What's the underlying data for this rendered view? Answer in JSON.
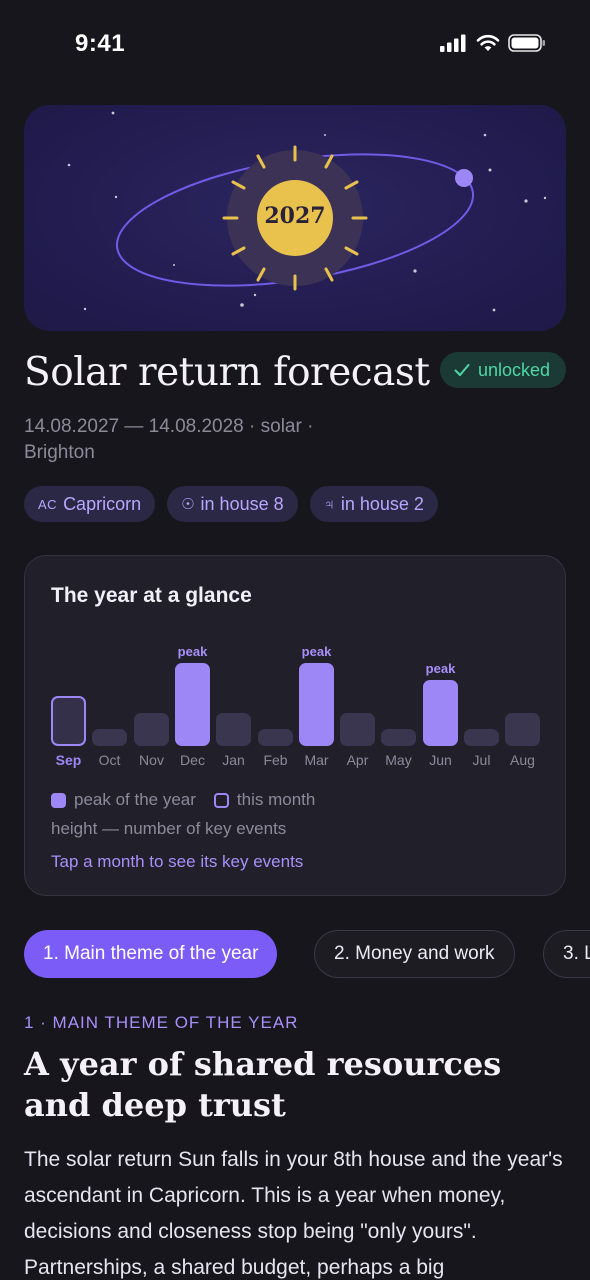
{
  "status_bar": {
    "time": "9:41"
  },
  "hero": {
    "year": "2027"
  },
  "header": {
    "title": "Solar return forecast",
    "badge": "unlocked",
    "subtitle": "14.08.2027 — 14.08.2028 · solar · Brighton"
  },
  "chips": [
    {
      "glyph": "AC",
      "label": "Capricorn",
      "icon": "ascendant-icon"
    },
    {
      "glyph": "☉",
      "label": "in house 8",
      "icon": "sun-icon"
    },
    {
      "glyph": "♃",
      "label": "in house 2",
      "icon": "jupiter-icon"
    }
  ],
  "glance_card": {
    "title": "The year at a glance",
    "peak_label": "peak",
    "legend_peak": "peak of the year",
    "legend_month": "this month",
    "legend_note": "height — number of key events",
    "tap_hint": "Tap a month to see its key events"
  },
  "chart_data": {
    "type": "bar",
    "categories": [
      "Sep",
      "Oct",
      "Nov",
      "Dec",
      "Jan",
      "Feb",
      "Mar",
      "Apr",
      "May",
      "Jun",
      "Jul",
      "Aug"
    ],
    "values": [
      3,
      1,
      2,
      5,
      2,
      1,
      5,
      2,
      1,
      4,
      1,
      2
    ],
    "peaks": [
      "Dec",
      "Mar",
      "Jun"
    ],
    "current": "Sep",
    "colors": {
      "peak": "#9d86f5",
      "normal": "#3a3650",
      "current_outline": "#9d86f5"
    }
  },
  "tabs": [
    {
      "label": "1. Main theme of the year",
      "active": true
    },
    {
      "label": "2. Money and work",
      "active": false
    },
    {
      "label": "3. L",
      "active": false
    }
  ],
  "section": {
    "kicker": "1 · MAIN THEME OF THE YEAR",
    "heading": "A year of shared resources and deep trust",
    "body": "The solar return Sun falls in your 8th house and the year's ascendant in Capricorn. This is a year when money, decisions and closeness stop being \"only yours\". Partnerships, a shared budget, perhaps a big"
  },
  "colors": {
    "accent": "#7b5cf6",
    "success": "#4fd6a5",
    "background": "#17161c",
    "card": "#21202a"
  }
}
